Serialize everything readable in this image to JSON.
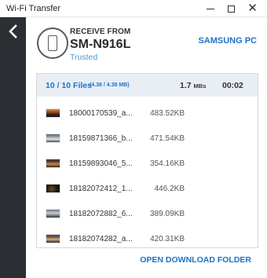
{
  "window": {
    "title": "Wi-Fi Transfer"
  },
  "header": {
    "receive_label": "RECEIVE FROM",
    "device_name": "SM-N916L",
    "status": "Trusted",
    "target": "SAMSUNG PC"
  },
  "summary": {
    "files": "10 / 10 Files",
    "size": "(4.38 / 4.38 MB)",
    "speed_value": "1.7",
    "speed_unit": "MBs",
    "elapsed": "00:02"
  },
  "files": [
    {
      "name": "18000170539_a...",
      "size": "483.52KB"
    },
    {
      "name": "18159871366_b...",
      "size": "471.54KB"
    },
    {
      "name": "18159893046_5...",
      "size": "354.16KB"
    },
    {
      "name": "18182072412_1...",
      "size": "446.2KB"
    },
    {
      "name": "18182072882_6...",
      "size": "389.09KB"
    },
    {
      "name": "18182074282_a...",
      "size": "420.31KB"
    }
  ],
  "actions": {
    "open_folder": "OPEN DOWNLOAD FOLDER"
  },
  "colors": {
    "accent": "#1e73c8",
    "trusted": "#4a98d1",
    "sidebar": "#2b2f33",
    "panel_head": "#e9eef4"
  }
}
